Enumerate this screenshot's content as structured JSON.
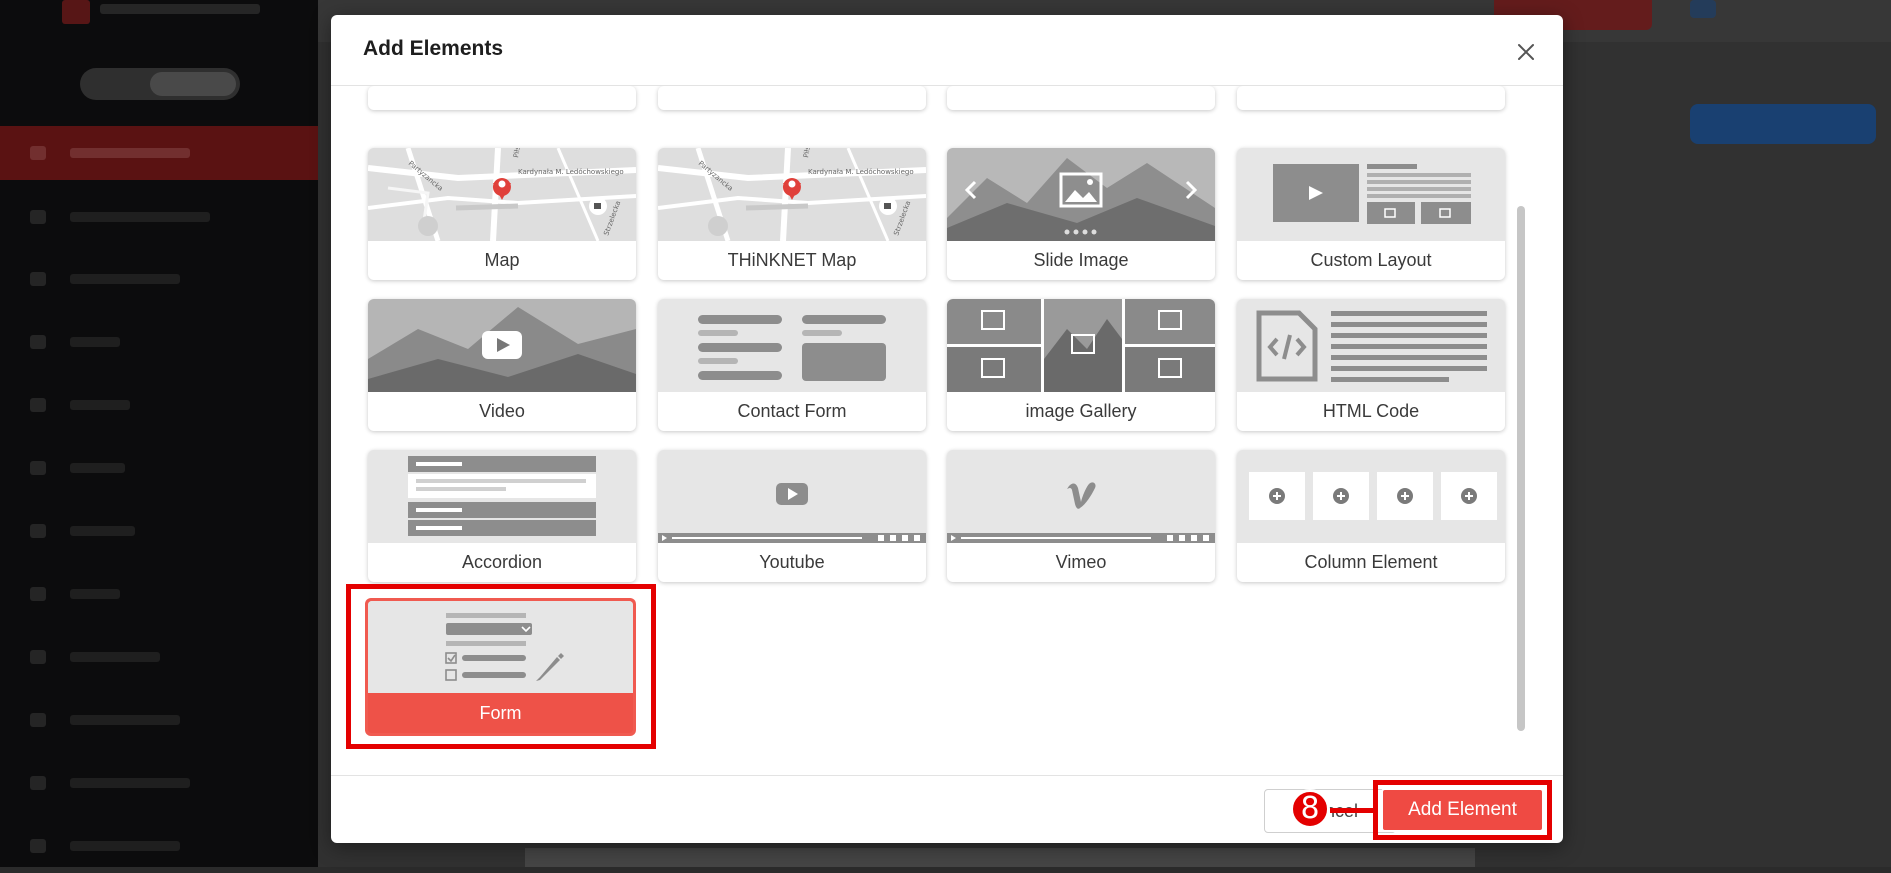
{
  "modal": {
    "title": "Add Elements"
  },
  "elements": [
    {
      "label": "Map",
      "icon": "map-thumbnail"
    },
    {
      "label": "THiNKNET Map",
      "icon": "map-thumbnail"
    },
    {
      "label": "Slide Image",
      "icon": "slide-image-thumbnail"
    },
    {
      "label": "Custom Layout",
      "icon": "custom-layout-thumbnail"
    },
    {
      "label": "Video",
      "icon": "video-thumbnail"
    },
    {
      "label": "Contact Form",
      "icon": "contact-form-thumbnail"
    },
    {
      "label": "image Gallery",
      "icon": "image-gallery-thumbnail"
    },
    {
      "label": "HTML Code",
      "icon": "html-code-thumbnail"
    },
    {
      "label": "Accordion",
      "icon": "accordion-thumbnail"
    },
    {
      "label": "Youtube",
      "icon": "youtube-thumbnail"
    },
    {
      "label": "Vimeo",
      "icon": "vimeo-thumbnail"
    },
    {
      "label": "Column Element",
      "icon": "column-element-thumbnail"
    },
    {
      "label": "Form",
      "icon": "form-thumbnail",
      "selected": true
    }
  ],
  "map_street_labels": [
    "Kardynała M. Ledóchowskiego",
    "Partyzancka",
    "Piłsudskiego",
    "Strzelecka"
  ],
  "footer": {
    "cancel_label": "Cancel",
    "add_label": "Add Element"
  },
  "annotation": {
    "step_number": "8"
  },
  "colors": {
    "accent": "#ee5248",
    "highlight": "#e40000"
  }
}
